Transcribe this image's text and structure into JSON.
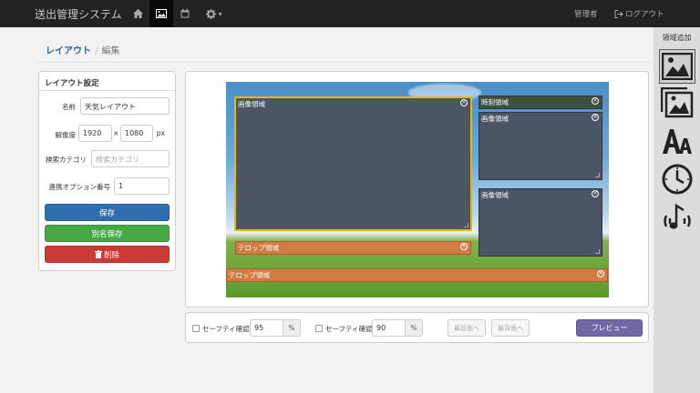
{
  "app": {
    "title": "送出管理システム",
    "user": "管理者",
    "logout": "ログアウト",
    "settings_caret": "▾"
  },
  "breadcrumb": {
    "parent": "レイアウト",
    "separator": "/",
    "current": "編集"
  },
  "layout_settings": {
    "title": "レイアウト設定",
    "name_label": "名前",
    "name_value": "天気レイアウト",
    "resolution_label": "解像度",
    "width": "1920",
    "height": "1080",
    "times": "×",
    "unit": "px",
    "category_label": "検索カテゴリ",
    "category_placeholder": "検索カテゴリ",
    "option_label": "連携オプション番号",
    "option_value": "1",
    "save": "保存",
    "save_as": "別名保存",
    "delete": "削除"
  },
  "regions": [
    {
      "label": "画像領域",
      "kind": "image",
      "selected": true
    },
    {
      "label": "時刻領域",
      "kind": "time"
    },
    {
      "label": "画像領域",
      "kind": "image"
    },
    {
      "label": "画像領域",
      "kind": "image"
    },
    {
      "label": "テロップ領域",
      "kind": "telop"
    },
    {
      "label": "テロップ領域",
      "kind": "telop"
    }
  ],
  "bottom_bar": {
    "safety1_label": "セーフティ確認",
    "safety1_value": "95",
    "safety2_label": "セーフティ確認",
    "safety2_value": "90",
    "percent": "%",
    "front": "最前面へ",
    "back": "最背面へ",
    "preview": "プレビュー"
  },
  "sidebar": {
    "title": "領域追加"
  },
  "colors": {
    "save": "#2f6eac",
    "save_as": "#45a845",
    "delete": "#cc3a36",
    "preview": "#7467a8",
    "telop": "#cf7d45",
    "region": "#4b5564",
    "selected_border": "#e6b800"
  }
}
